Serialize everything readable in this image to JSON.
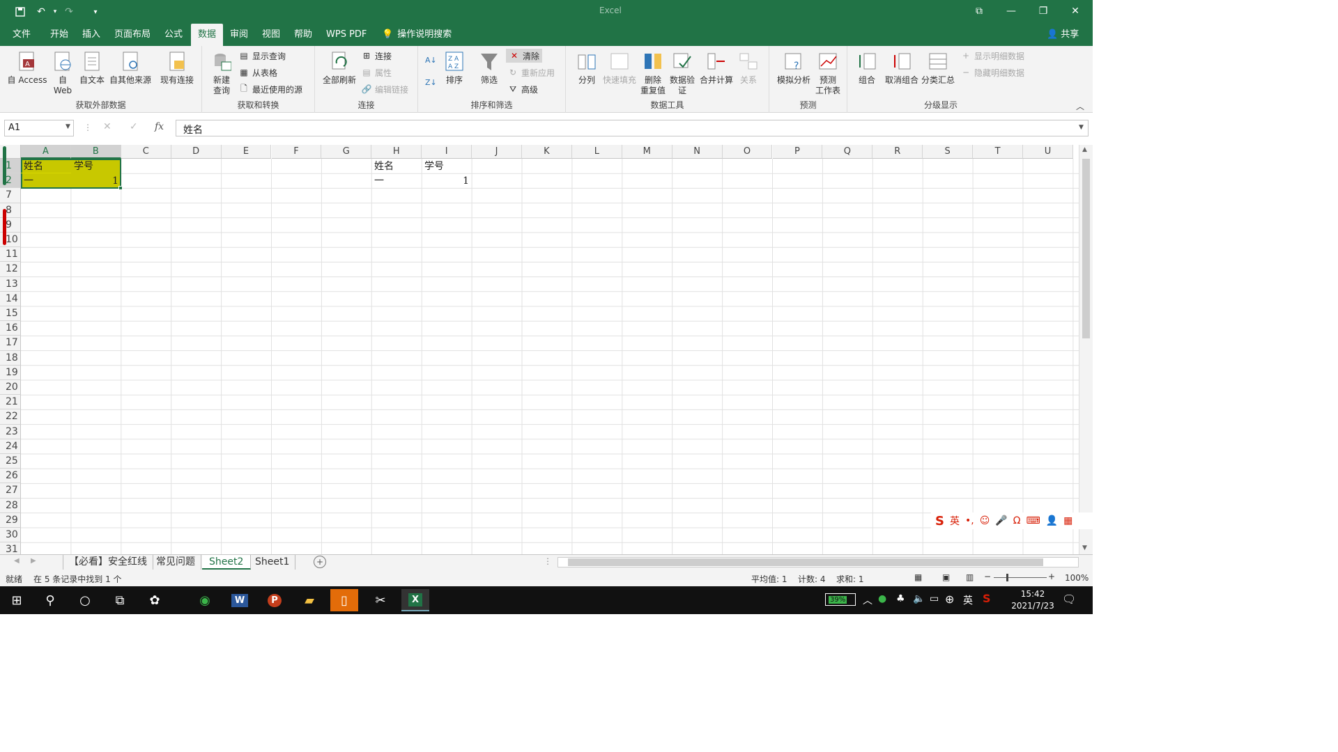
{
  "app": {
    "title": "Excel",
    "share": "共享"
  },
  "tabs": [
    "文件",
    "开始",
    "插入",
    "页面布局",
    "公式",
    "数据",
    "审阅",
    "视图",
    "帮助",
    "WPS PDF"
  ],
  "active_tab": "数据",
  "tell_me": "操作说明搜索",
  "ribbon": {
    "get_external": {
      "label": "获取外部数据",
      "access": "自 Access",
      "web": "自\nWeb",
      "text": "自文本",
      "other": "自其他来源",
      "existing": "现有连接"
    },
    "transform": {
      "label": "获取和转换",
      "new_query": "新建\n查询",
      "show_queries": "显示查询",
      "from_table": "从表格",
      "recent": "最近使用的源"
    },
    "connections": {
      "label": "连接",
      "refresh": "全部刷新",
      "conn": "连接",
      "props": "属性",
      "edit_links": "编辑链接"
    },
    "sort": {
      "label": "排序和筛选",
      "sort": "排序",
      "filter": "筛选",
      "clear": "清除",
      "reapply": "重新应用",
      "advanced": "高级"
    },
    "tools": {
      "label": "数据工具",
      "split": "分列",
      "flash": "快速填充",
      "dedupe": "删除\n重复值",
      "validate": "数据验\n证",
      "consolidate": "合并计算",
      "relations": "关系"
    },
    "forecast": {
      "label": "预测",
      "whatif": "模拟分析",
      "sheet": "预测\n工作表"
    },
    "outline": {
      "label": "分级显示",
      "group": "组合",
      "ungroup": "取消组合",
      "subtotal": "分类汇总",
      "show": "显示明细数据",
      "hide": "隐藏明细数据"
    }
  },
  "formula_bar": {
    "name": "A1",
    "fx": "fx",
    "value": "姓名"
  },
  "columns": [
    "A",
    "B",
    "C",
    "D",
    "E",
    "F",
    "G",
    "H",
    "I",
    "J",
    "K",
    "L",
    "M",
    "N",
    "O",
    "P",
    "Q",
    "R",
    "S",
    "T",
    "U"
  ],
  "rows": [
    "1",
    "2",
    "7",
    "8",
    "9",
    "10",
    "11",
    "12",
    "13",
    "14",
    "15",
    "16",
    "17",
    "18",
    "19",
    "20",
    "21",
    "22",
    "23",
    "24",
    "25",
    "26",
    "27",
    "28",
    "29",
    "30",
    "31"
  ],
  "cells": {
    "A1": "姓名",
    "B1": "学号",
    "A2": "一",
    "B2": "1",
    "H1": "姓名",
    "I1": "学号",
    "H2": "一",
    "I2": "1"
  },
  "sheets": [
    "【必看】安全红线",
    "常见问题",
    "Sheet2",
    "Sheet1"
  ],
  "active_sheet": "Sheet2",
  "status": {
    "mode": "就绪",
    "filter_msg": "在 5 条记录中找到 1 个",
    "avg": "平均值: 1",
    "count": "计数: 4",
    "sum": "求和: 1",
    "zoom": "100%"
  },
  "taskbar": {
    "battery": "39%",
    "ime": "英",
    "time": "15:42",
    "date": "2021/7/23"
  },
  "ime_bar": {
    "lang": "英"
  },
  "colors": {
    "accent": "#217346",
    "highlight": "#c8c800"
  }
}
